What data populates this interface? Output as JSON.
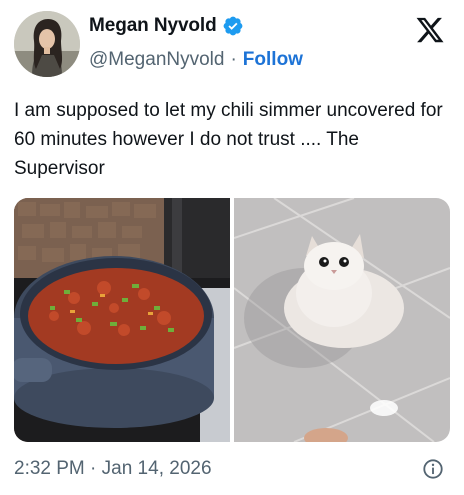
{
  "author": {
    "display_name": "Megan Nyvold",
    "handle": "@MeganNyvold",
    "separator": "·",
    "follow_label": "Follow",
    "verified": true
  },
  "tweet": {
    "text": "I am supposed to let my chili simmer uncovered for 60 minutes however I do not trust .... The Supervisor",
    "timestamp": "2:32 PM · Jan 14, 2026"
  },
  "icons": {
    "verified": "verified-badge-icon",
    "logo": "x-logo-icon",
    "info": "info-icon"
  },
  "colors": {
    "accent": "#1d9bf0",
    "follow": "#1d73d6",
    "secondary_text": "#536471"
  }
}
